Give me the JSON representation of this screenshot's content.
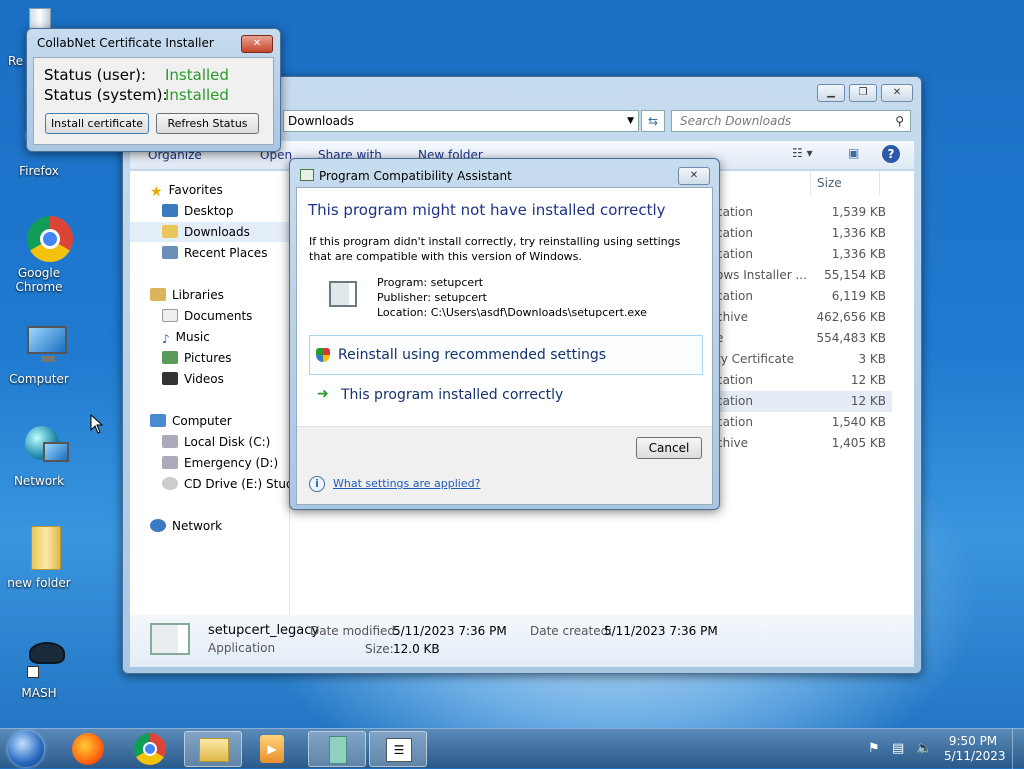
{
  "desktop": {
    "icons": [
      {
        "label": "Re"
      },
      {
        "label": "Firefox"
      },
      {
        "label": "Google Chrome"
      },
      {
        "label": "Computer"
      },
      {
        "label": "Network"
      },
      {
        "label": "new folder"
      },
      {
        "label": "MASH"
      }
    ]
  },
  "certificate_installer": {
    "title": "CollabNet Certificate Installer",
    "status_user_label": "Status (user):",
    "status_user_value": "Installed",
    "status_system_label": "Status (system):",
    "status_system_value": "Installed",
    "install_button": "Install certificate",
    "refresh_button": "Refresh Status",
    "status_color": "#2a9a2a"
  },
  "explorer": {
    "address": "Downloads",
    "search_placeholder": "Search Downloads",
    "toolbar": {
      "organize": "Organize",
      "open": "Open",
      "share_with": "Share with",
      "new_folder": "New folder"
    },
    "nav": {
      "favorites": "Favorites",
      "desktop": "Desktop",
      "downloads": "Downloads",
      "recent_places": "Recent Places",
      "libraries": "Libraries",
      "documents": "Documents",
      "music": "Music",
      "pictures": "Pictures",
      "videos": "Videos",
      "computer": "Computer",
      "local_disk": "Local Disk (C:)",
      "emergency": "Emergency (D:)",
      "cd_drive": "CD Drive (E:) Studio",
      "network": "Network"
    },
    "size_header": "Size",
    "rows": [
      {
        "type": "cation",
        "size": "1,539 KB"
      },
      {
        "type": "cation",
        "size": "1,336 KB"
      },
      {
        "type": "cation",
        "size": "1,336 KB"
      },
      {
        "type": "ows Installer ...",
        "size": "55,154 KB"
      },
      {
        "type": "cation",
        "size": "6,119 KB"
      },
      {
        "type": "chive",
        "size": "462,656 KB"
      },
      {
        "type": "e",
        "size": "554,483 KB"
      },
      {
        "type": "ty Certificate",
        "size": "3 KB"
      },
      {
        "type": "cation",
        "size": "12 KB"
      },
      {
        "type": "cation",
        "size": "12 KB"
      },
      {
        "type": "cation",
        "size": "1,540 KB"
      },
      {
        "type": "chive",
        "size": "1,405 KB"
      }
    ],
    "details": {
      "name": "setupcert_legacy",
      "type": "Application",
      "modified_label": "Date modified:",
      "modified": "5/11/2023 7:36 PM",
      "created_label": "Date created:",
      "created": "5/11/2023 7:36 PM",
      "size_label": "Size:",
      "size": "12.0 KB"
    }
  },
  "pca": {
    "title": "Program Compatibility Assistant",
    "heading": "This program might not have installed correctly",
    "body": "If this program didn't install correctly, try reinstalling using settings that are compatible with this version of Windows.",
    "program": "Program: setupcert",
    "publisher": "Publisher: setupcert",
    "location": "Location: C:\\Users\\asdf\\Downloads\\setupcert.exe",
    "option_reinstall": "Reinstall using recommended settings",
    "option_ok": "This program installed correctly",
    "cancel": "Cancel",
    "help_link": "What settings are applied?"
  },
  "taskbar": {
    "time": "9:50 PM",
    "date": "5/11/2023"
  }
}
